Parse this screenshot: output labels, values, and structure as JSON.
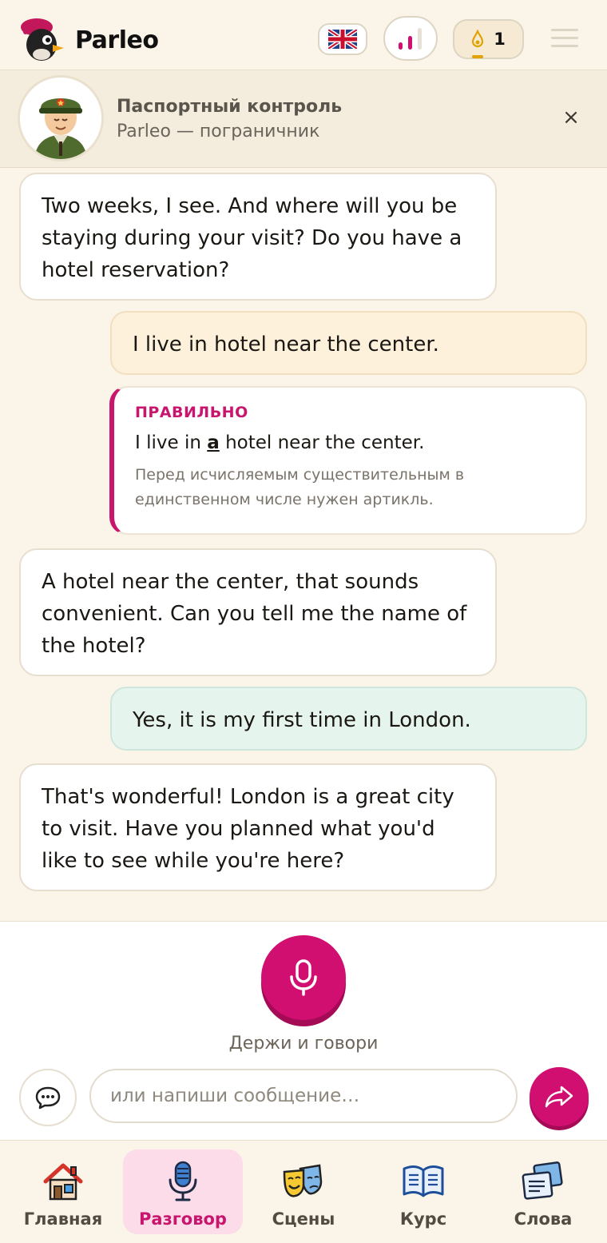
{
  "app": {
    "name": "Parleo"
  },
  "header": {
    "flag_icon": "uk-flag-icon",
    "level_icon": "bars-level-icon",
    "streak_count": "1",
    "streak_icon": "flame-icon",
    "menu_icon": "hamburger-icon"
  },
  "scenario": {
    "title": "Паспортный контроль",
    "subtitle": "Parleo — пограничник",
    "close_label": "×"
  },
  "messages": {
    "m1": "Two weeks, I see. And where will you be staying during your visit? Do you have a hotel reservation?",
    "m2": "I live in hotel near the center.",
    "correction": {
      "label": "ПРАВИЛЬНО",
      "before": "I live in ",
      "highlight": "a",
      "after": " hotel near the center.",
      "note": "Перед исчисляемым существительным в единственном числе нужен артикль."
    },
    "m3": "A hotel near the center, that sounds convenient. Can you tell me the name of the hotel?",
    "m4": "Yes, it is my first time in London.",
    "m5": "That's wonderful! London is a great city to visit. Have you planned what you'd like to see while you're here?"
  },
  "composer": {
    "mic_label": "Держи и говори",
    "input_placeholder": "или напиши сообщение…",
    "input_value": ""
  },
  "nav": {
    "items": [
      {
        "label": "Главная",
        "icon": "house-icon"
      },
      {
        "label": "Разговор",
        "icon": "microphone-icon"
      },
      {
        "label": "Сцены",
        "icon": "theater-masks-icon"
      },
      {
        "label": "Курс",
        "icon": "open-book-icon"
      },
      {
        "label": "Слова",
        "icon": "flashcards-icon"
      }
    ],
    "active_index": 1
  },
  "colors": {
    "accent": "#d10f71",
    "background": "#fbf5e9",
    "nav_active_bg": "#fbdce8",
    "user_warn_bg": "#fdf1dc",
    "user_ok_bg": "#e6f4ee"
  }
}
